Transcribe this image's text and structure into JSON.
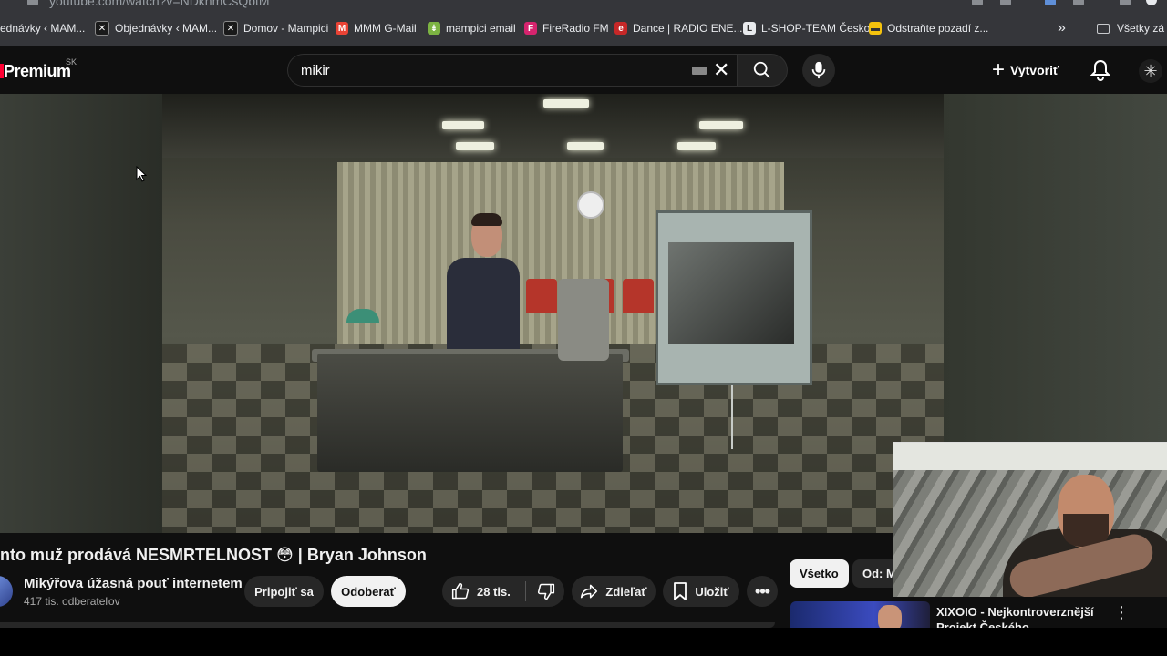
{
  "browser": {
    "url": "youtube.com/watch?v=NDkhmCsQbtM",
    "bookmarks": [
      {
        "label": "ednávky ‹ MAM...",
        "icon": "wordpress-icon"
      },
      {
        "label": "Objednávky ‹ MAM...",
        "icon": "puzzle-icon"
      },
      {
        "label": "Domov - Mampici",
        "icon": "puzzle-icon"
      },
      {
        "label": "MMM G-Mail",
        "icon": "gmail-icon"
      },
      {
        "label": "mampici email",
        "icon": "leaf-icon"
      },
      {
        "label": "FireRadio FM",
        "icon": "fireradio-icon"
      },
      {
        "label": "Dance | RADIO ENE...",
        "icon": "energy-radio-icon"
      },
      {
        "label": "L-SHOP-TEAM Česko",
        "icon": "lshop-icon"
      },
      {
        "label": "Odstraňte pozadí z...",
        "icon": "removebg-icon"
      }
    ],
    "all_bookmarks_label": "Všetky zá"
  },
  "header": {
    "logo_text": "Premium",
    "logo_region": "SK",
    "search_value": "mikir",
    "create_label": "Vytvoriť"
  },
  "video": {
    "title": "nto muž prodává NESMRTELNOST 😳 | Bryan Johnson",
    "channel_name": "Mikýřova úžasná pouť internetem",
    "subscribers": "417 tis. odberateľov",
    "join_label": "Pripojiť sa",
    "subscribe_label": "Odoberať",
    "likes": "28 tis.",
    "share_label": "Zdieľať",
    "save_label": "Uložiť"
  },
  "sidebar": {
    "chips": [
      "Všetko",
      "Od: M"
    ],
    "recommendation_title": "XIXOIO - Nejkontroverznější Projekt Českého Kryptosvěta"
  },
  "colors": {
    "page_bg": "#0f0f0f",
    "chip_active_bg": "#f1f1f1",
    "pill_bg": "#272727",
    "brand_red": "#ff0033"
  }
}
